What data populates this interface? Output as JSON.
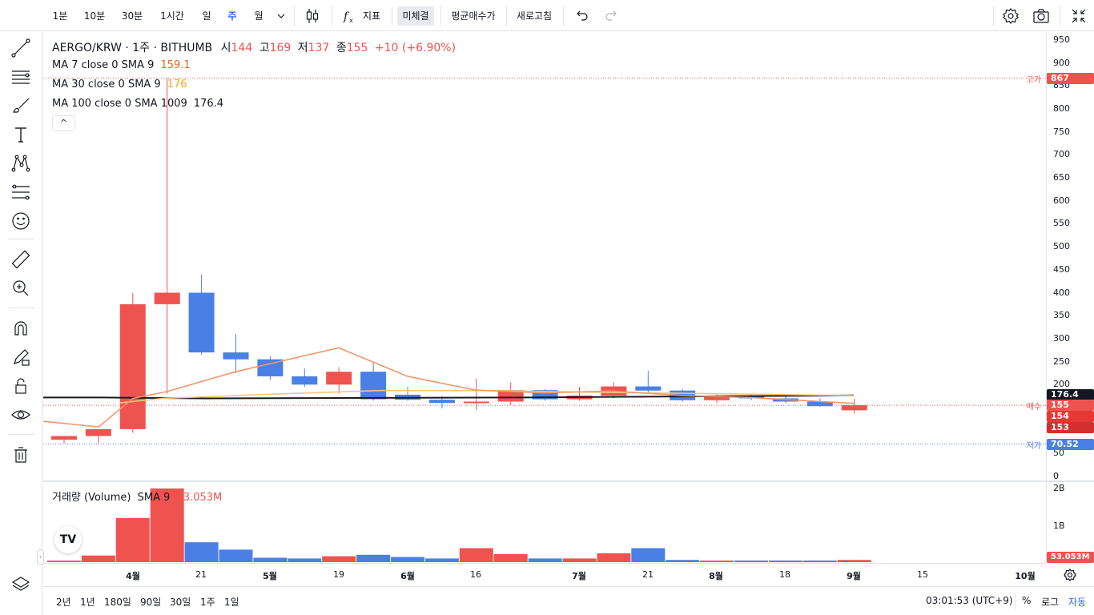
{
  "toolbar": {
    "intervals": [
      "1분",
      "10분",
      "30분",
      "1시간",
      "일",
      "주",
      "월"
    ],
    "active_interval": "주",
    "indicators_label": "지표",
    "pending_label": "미체결",
    "avg_price_label": "평균매수가",
    "refresh_label": "새로고침"
  },
  "legend": {
    "symbol": "AERGO/KRW · 1주 · BITHUMB",
    "open_label": "시",
    "open": "144",
    "high_label": "고",
    "high": "169",
    "low_label": "저",
    "low": "137",
    "close_label": "종",
    "close": "155",
    "change": "+10 (+6.90%)",
    "ma7_label": "MA 7 close 0 SMA 9",
    "ma7_value": "159.1",
    "ma30_label": "MA 30 close 0 SMA 9",
    "ma30_value": "176",
    "ma100_label": "MA 100 close 0 SMA 1009",
    "ma100_value": "176.4",
    "collapse": "^"
  },
  "volume_legend": {
    "label": "거래량 (Volume)",
    "sma": "SMA 9",
    "value": "53.053M"
  },
  "price_axis": {
    "ticks": [
      "950",
      "900",
      "850",
      "800",
      "750",
      "700",
      "650",
      "600",
      "550",
      "500",
      "450",
      "400",
      "350",
      "300",
      "250",
      "200",
      "150",
      "100",
      "50",
      "0"
    ],
    "high_note": "고가",
    "high_value": "867",
    "buy_note": "매수",
    "buy_value": "155",
    "ma100_value": "176.4",
    "val_154": "154",
    "val_153": "153",
    "low_note": "저가",
    "low_value": "70.52"
  },
  "volume_axis": {
    "ticks": [
      "2B",
      "1B"
    ],
    "last_value": "53.053M"
  },
  "time_axis": {
    "labels": [
      "4월",
      "21",
      "5월",
      "19",
      "6월",
      "16",
      "7월",
      "21",
      "8월",
      "18",
      "9월",
      "15",
      "10월"
    ]
  },
  "bottom": {
    "ranges": [
      "2년",
      "1년",
      "180일",
      "90일",
      "30일",
      "1주",
      "1일"
    ],
    "clock": "03:01:53 (UTC+9)",
    "percent": "%",
    "log": "로그",
    "auto": "자동"
  },
  "logo_text": "TV",
  "colors": {
    "up": "#ef5350",
    "down": "#4a7fe6",
    "ma7": "#f0976a",
    "ma30": "#f6c67e",
    "ma100": "#1a1a1a",
    "accent": "#2962ff"
  },
  "chart_data": {
    "type": "candlestick",
    "interval": "1주",
    "ohlc": [
      {
        "o": 80,
        "h": 88,
        "l": 72,
        "c": 88
      },
      {
        "o": 88,
        "h": 103,
        "l": 72,
        "c": 103
      },
      {
        "o": 103,
        "h": 400,
        "l": 95,
        "c": 375
      },
      {
        "o": 375,
        "h": 867,
        "l": 180,
        "c": 400
      },
      {
        "o": 400,
        "h": 440,
        "l": 265,
        "c": 270
      },
      {
        "o": 270,
        "h": 310,
        "l": 225,
        "c": 255
      },
      {
        "o": 255,
        "h": 262,
        "l": 210,
        "c": 218
      },
      {
        "o": 218,
        "h": 235,
        "l": 195,
        "c": 200
      },
      {
        "o": 200,
        "h": 238,
        "l": 180,
        "c": 228
      },
      {
        "o": 228,
        "h": 250,
        "l": 165,
        "c": 168
      },
      {
        "o": 178,
        "h": 195,
        "l": 165,
        "c": 167
      },
      {
        "o": 167,
        "h": 175,
        "l": 148,
        "c": 160
      },
      {
        "o": 160,
        "h": 213,
        "l": 145,
        "c": 163
      },
      {
        "o": 163,
        "h": 205,
        "l": 155,
        "c": 188
      },
      {
        "o": 188,
        "h": 190,
        "l": 165,
        "c": 168
      },
      {
        "o": 168,
        "h": 195,
        "l": 165,
        "c": 176
      },
      {
        "o": 176,
        "h": 205,
        "l": 170,
        "c": 196
      },
      {
        "o": 196,
        "h": 230,
        "l": 180,
        "c": 187
      },
      {
        "o": 187,
        "h": 190,
        "l": 163,
        "c": 166
      },
      {
        "o": 166,
        "h": 178,
        "l": 160,
        "c": 175
      },
      {
        "o": 175,
        "h": 178,
        "l": 166,
        "c": 170
      },
      {
        "o": 170,
        "h": 175,
        "l": 160,
        "c": 163
      },
      {
        "o": 163,
        "h": 170,
        "l": 152,
        "c": 153
      },
      {
        "o": 144,
        "h": 169,
        "l": 137,
        "c": 155
      }
    ],
    "ma7": [
      40,
      20,
      null,
      180,
      225,
      253,
      280,
      214,
      196,
      189,
      188,
      182,
      180,
      177,
      171,
      165,
      163,
      159.1
    ],
    "ma30": [
      null,
      null,
      null,
      null,
      null,
      178,
      182,
      186,
      187,
      186,
      185,
      184,
      182,
      181,
      180,
      178,
      177,
      176
    ],
    "ma100_level": 176.4,
    "volume": [
      0.02,
      0.09,
      0.6,
      1.0,
      0.27,
      0.17,
      0.06,
      0.05,
      0.08,
      0.1,
      0.07,
      0.05,
      0.19,
      0.11,
      0.05,
      0.05,
      0.12,
      0.19,
      0.03,
      0.02,
      0.02,
      0.02,
      0.01,
      0.03
    ],
    "volume_unit": "B",
    "ylim": [
      0,
      950
    ]
  }
}
